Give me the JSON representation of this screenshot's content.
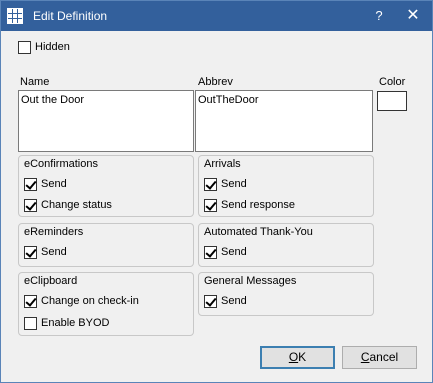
{
  "window": {
    "title": "Edit Definition",
    "help_label": "?",
    "close_label": "✕"
  },
  "hidden": {
    "label": "Hidden",
    "checked": false
  },
  "name": {
    "label": "Name",
    "value": "Out the Door"
  },
  "abbrev": {
    "label": "Abbrev",
    "value": "OutTheDoor"
  },
  "color": {
    "label": "Color",
    "value": "#ffffff"
  },
  "groups": {
    "econfirmations": {
      "title": "eConfirmations",
      "send": {
        "label": "Send",
        "checked": true
      },
      "change_status": {
        "label": "Change status",
        "checked": true
      }
    },
    "arrivals": {
      "title": "Arrivals",
      "send": {
        "label": "Send",
        "checked": true
      },
      "send_response": {
        "label": "Send response",
        "checked": true
      }
    },
    "ereminders": {
      "title": "eReminders",
      "send": {
        "label": "Send",
        "checked": true
      }
    },
    "automated_thank_you": {
      "title": "Automated Thank-You",
      "send": {
        "label": "Send",
        "checked": true
      }
    },
    "eclipboard": {
      "title": "eClipboard",
      "change_on_checkin": {
        "label": "Change on check-in",
        "checked": true
      },
      "enable_byod": {
        "label": "Enable BYOD",
        "checked": false
      }
    },
    "general_messages": {
      "title": "General Messages",
      "send": {
        "label": "Send",
        "checked": true
      }
    }
  },
  "buttons": {
    "ok_accel": "O",
    "ok_rest": "K",
    "cancel_accel": "C",
    "cancel_rest": "ancel"
  }
}
